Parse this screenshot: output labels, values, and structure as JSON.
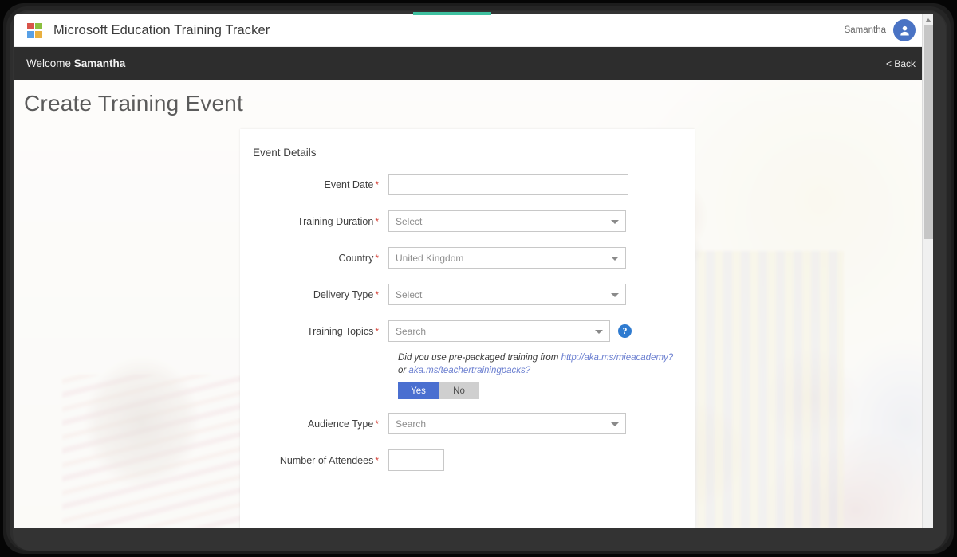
{
  "header": {
    "logo_icon": "microsoft-logo-icon",
    "app_title": "Microsoft Education Training Tracker",
    "username": "Samantha",
    "avatar_icon": "user-avatar-icon"
  },
  "welcome_bar": {
    "greeting_prefix": "Welcome ",
    "greeting_name": "Samantha",
    "back_label": "< Back"
  },
  "page": {
    "title": "Create Training Event"
  },
  "form": {
    "panel_heading": "Event Details",
    "required_marker": "*",
    "fields": [
      {
        "label": "Event Date",
        "required": true,
        "type": "text",
        "value": "",
        "placeholder": ""
      },
      {
        "label": "Training Duration",
        "required": true,
        "type": "select",
        "value": "Select"
      },
      {
        "label": "Country",
        "required": true,
        "type": "select",
        "value": "United Kingdom"
      },
      {
        "label": "Delivery Type",
        "required": true,
        "type": "select",
        "value": "Select"
      },
      {
        "label": "Training Topics",
        "required": true,
        "type": "search-select",
        "value": "Search",
        "help_icon": "question-mark-help-icon"
      },
      {
        "label": "Audience Type",
        "required": true,
        "type": "search-select",
        "value": "Search"
      },
      {
        "label": "Number of Attendees",
        "required": true,
        "type": "text",
        "value": "",
        "placeholder": ""
      }
    ],
    "prepackaged": {
      "text_part1": "Did you use pre-packaged training from ",
      "link1": "http://aka.ms/mieacademy?",
      "text_part2": " or ",
      "link2": "aka.ms/teachertrainingpacks?",
      "yes_label": "Yes",
      "no_label": "No",
      "selected": "Yes"
    }
  },
  "colors": {
    "accent_blue": "#4a6fd0",
    "help_blue": "#2f7bd0",
    "required_red": "#d6453b",
    "dark_bar": "#2d2d2d",
    "top_stripe_teal": "#3fc1a0",
    "link_blue": "#6b7fd0"
  }
}
